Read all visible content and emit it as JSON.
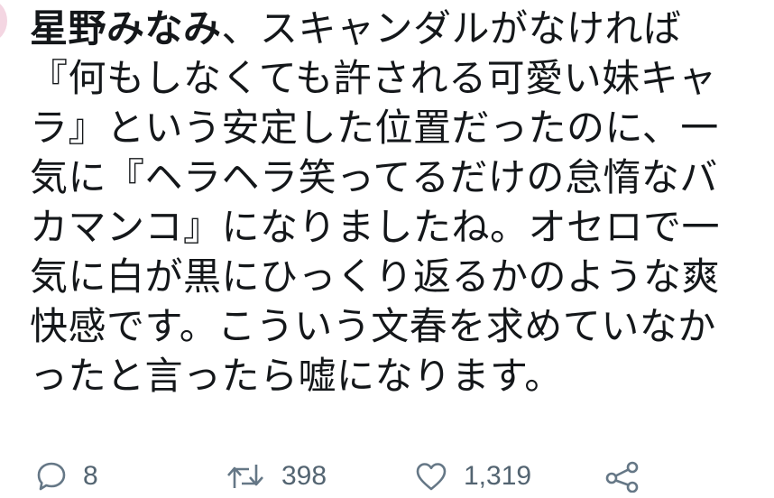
{
  "tweet": {
    "author": "星野みなみ",
    "lines": [
      "、スキャンダルがなければ",
      "『何もしなくても許される可愛い妹キャ",
      "ラ』という安定した位置だったのに、一",
      "気に『ヘラヘラ笑ってるだけの怠惰なバ",
      "カマンコ』になりましたね。オセロで一",
      "気に白が黒にひっくり返るかのような爽",
      "快感です。こういう文春を求めていなか",
      "ったと言ったら嘘になります。"
    ]
  },
  "actions": {
    "reply_count": "8",
    "retweet_count": "398",
    "like_count": "1,319"
  },
  "icons": {
    "reply": "reply-icon",
    "retweet": "retweet-icon",
    "like": "heart-icon",
    "share": "share-icon"
  },
  "colors": {
    "text": "#14171a",
    "icon_gray": "#657786"
  }
}
